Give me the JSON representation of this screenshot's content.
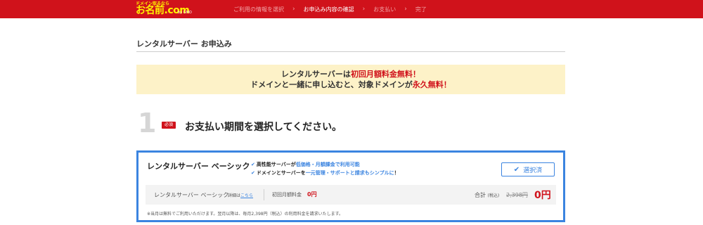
{
  "header": {
    "logo_tagline": "ドメイン取るなら",
    "logo_text": "お名前.com",
    "logo_sub": "by GMO",
    "steps": [
      {
        "label": "ご利用の情報を選択",
        "active": false
      },
      {
        "label": "お申込み内容の確認",
        "active": true
      },
      {
        "label": "お支払い",
        "active": false
      },
      {
        "label": "完了",
        "active": false
      }
    ],
    "colors": {
      "brand_red": "#d0121b",
      "logo_yellow": "#fff200"
    }
  },
  "page": {
    "title": "レンタルサーバー お申込み"
  },
  "banner": {
    "line1_pre": "レンタルサーバーは",
    "line1_hl": "初回月額料金無料！",
    "line2_pre": "ドメインと一緒に申し込むと、対象ドメインが",
    "line2_hl": "永久無料！"
  },
  "section": {
    "number": "1",
    "required_badge": "必須",
    "title": "お支払い期間を選択してください。"
  },
  "plan": {
    "name": "レンタルサーバー ベーシック",
    "features": [
      {
        "pre": "高性能サーバーが",
        "hl": "低価格・月額課金で利用可能",
        "post": ""
      },
      {
        "pre": "ドメインとサーバーを",
        "hl": "一元管理・サポートと請求もシンプルに",
        "post": "！"
      }
    ],
    "select_button": "選択済",
    "summary": {
      "name": "レンタルサーバー ベーシック",
      "detail_pre": "詳細は",
      "detail_link": "こちら",
      "fee_label": "初回月額料金",
      "fee_value": "0円",
      "total_label": "合計",
      "total_tax": "(税込)",
      "total_old": "2,398円",
      "total_new": "0円"
    },
    "note": "※当月は無料でご利用いただけます。翌月以降は、毎月2,398円（税込）の利用料金を請求いたします。",
    "colors": {
      "accent_blue": "#3b84e0"
    }
  }
}
